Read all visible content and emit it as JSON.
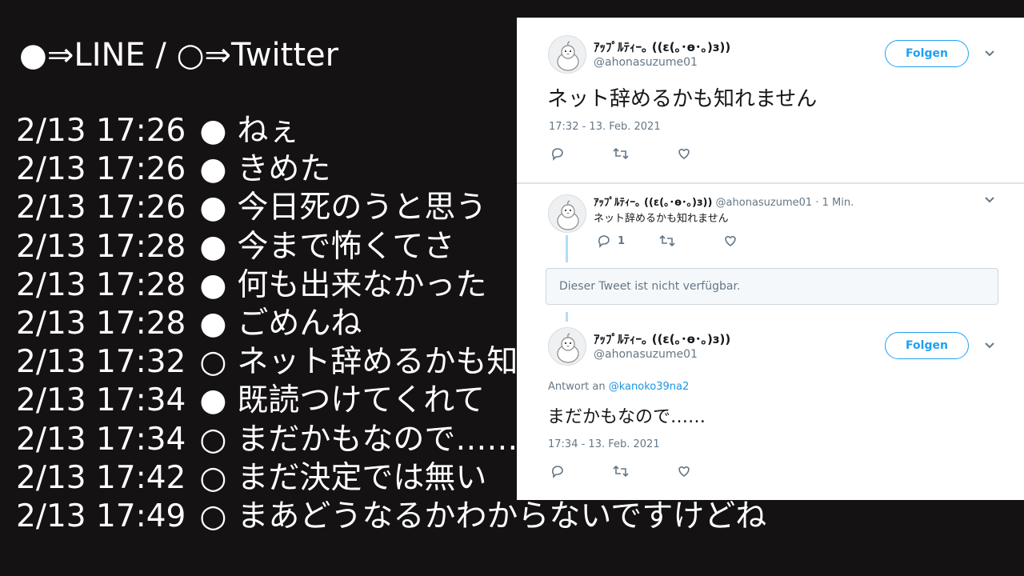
{
  "legend": "●⇒LINE / ○⇒Twitter",
  "log": [
    {
      "time": "2/13 17:26",
      "mark": "●",
      "text": "ねぇ"
    },
    {
      "time": "2/13 17:26",
      "mark": "●",
      "text": "きめた"
    },
    {
      "time": "2/13 17:26",
      "mark": "●",
      "text": "今日死のうと思う"
    },
    {
      "time": "2/13 17:28",
      "mark": "●",
      "text": "今まで怖くてさ"
    },
    {
      "time": "2/13 17:28",
      "mark": "●",
      "text": "何も出来なかった"
    },
    {
      "time": "2/13 17:28",
      "mark": "●",
      "text": "ごめんね"
    },
    {
      "time": "2/13 17:32",
      "mark": "○",
      "text": "ネット辞めるかも知れません"
    },
    {
      "time": "2/13 17:34",
      "mark": "●",
      "text": "既読つけてくれて"
    },
    {
      "time": "2/13 17:34",
      "mark": "○",
      "text": "まだかもなので……"
    },
    {
      "time": "2/13 17:42",
      "mark": "○",
      "text": "まだ決定では無い"
    },
    {
      "time": "2/13 17:49",
      "mark": "○",
      "text": "まあどうなるかわからないですけどね"
    }
  ],
  "tweet1": {
    "name": "ｱｯﾌﾟﾙﾃｨｰ｡ ((ε(｡･ө･｡)з))",
    "handle": "@ahonasuzume01",
    "follow_label": "Folgen",
    "text": "ネット辞めるかも知れません",
    "meta": "17:32 - 13. Feb. 2021"
  },
  "tweet2": {
    "name": "ｱｯﾌﾟﾙﾃｨｰ｡ ((ε(｡･ө･｡)з))",
    "handle": "@ahonasuzume01",
    "age": "· 1 Min.",
    "text": "ネット辞めるかも知れません",
    "reply_count": "1"
  },
  "unavailable": "Dieser Tweet ist nicht verfügbar.",
  "tweet3": {
    "name": "ｱｯﾌﾟﾙﾃｨｰ｡ ((ε(｡･ө･｡)з))",
    "handle": "@ahonasuzume01",
    "follow_label": "Folgen",
    "reply_prefix": "Antwort an",
    "reply_to": "@kanoko39na2",
    "text": "まだかもなので……",
    "meta": "17:34 - 13. Feb. 2021"
  },
  "colors": {
    "twitter_blue": "#1da1f2",
    "background": "#141212"
  },
  "icons": [
    "reply-icon",
    "retweet-icon",
    "like-icon",
    "chevron-down-icon",
    "avatar-bird-icon"
  ]
}
